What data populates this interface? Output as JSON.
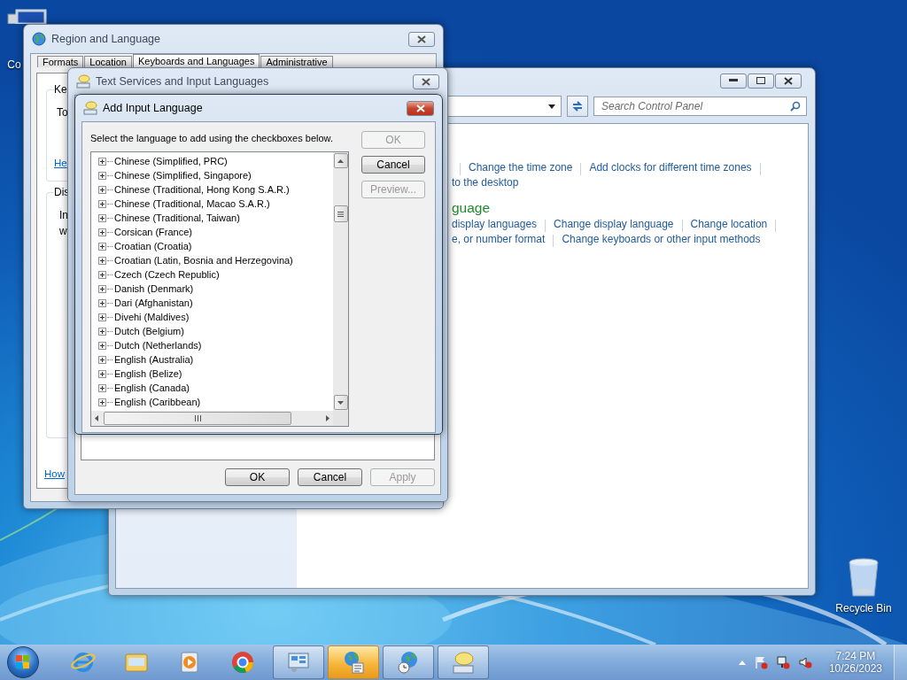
{
  "desktop_icons": [
    {
      "kind": "computer",
      "label": "Co"
    },
    {
      "kind": "recycle-bin",
      "label": "Recycle Bin"
    }
  ],
  "control_panel": {
    "search": {
      "placeholder": "Search Control Panel"
    },
    "content": [
      {
        "kind": "links",
        "separator_before": true,
        "links": [
          {
            "text": "Change the time zone",
            "separator_after": true
          },
          {
            "text": "Add clocks for different time zones",
            "separator_after": true
          }
        ]
      },
      {
        "kind": "links",
        "separator_before": false,
        "links": [
          {
            "text": "to the desktop",
            "separator_after": false
          }
        ]
      },
      {
        "kind": "heading",
        "text": "guage"
      },
      {
        "kind": "links",
        "separator_before": false,
        "links": [
          {
            "text": "display languages",
            "separator_after": true
          },
          {
            "text": "Change display language",
            "separator_after": true
          },
          {
            "text": "Change location",
            "separator_after": true
          }
        ]
      },
      {
        "kind": "links",
        "separator_before": false,
        "links": [
          {
            "text": "e, or number format",
            "separator_after": true
          },
          {
            "text": "Change keyboards or other input methods",
            "separator_after": false
          }
        ]
      }
    ]
  },
  "region_window": {
    "title": "Region and Language",
    "tabs": [
      {
        "label": "Formats",
        "selected": false
      },
      {
        "label": "Location",
        "selected": false
      },
      {
        "label": "Keyboards and Languages",
        "selected": true
      },
      {
        "label": "Administrative",
        "selected": false
      }
    ],
    "groups": [
      {
        "title": "Ke",
        "lines": [
          "To"
        ],
        "link": "He"
      },
      {
        "title": "Dis",
        "lines": [
          "In",
          "w"
        ]
      }
    ],
    "help_link": "How"
  },
  "text_services_window": {
    "title": "Text Services and Input Languages",
    "buttons": [
      {
        "label": "OK",
        "disabled": false
      },
      {
        "label": "Cancel",
        "disabled": false
      },
      {
        "label": "Apply",
        "disabled": true
      }
    ]
  },
  "add_language_dialog": {
    "title": "Add Input Language",
    "instruction": "Select the language to add using the checkboxes below.",
    "languages": [
      {
        "label": "Chinese (Simplified, PRC)",
        "expanded": false
      },
      {
        "label": "Chinese (Simplified, Singapore)",
        "expanded": false
      },
      {
        "label": "Chinese (Traditional, Hong Kong S.A.R.)",
        "expanded": false
      },
      {
        "label": "Chinese (Traditional, Macao S.A.R.)",
        "expanded": false
      },
      {
        "label": "Chinese (Traditional, Taiwan)",
        "expanded": false
      },
      {
        "label": "Corsican (France)",
        "expanded": false
      },
      {
        "label": "Croatian (Croatia)",
        "expanded": false
      },
      {
        "label": "Croatian (Latin, Bosnia and Herzegovina)",
        "expanded": false
      },
      {
        "label": "Czech (Czech Republic)",
        "expanded": false
      },
      {
        "label": "Danish (Denmark)",
        "expanded": false
      },
      {
        "label": "Dari (Afghanistan)",
        "expanded": false
      },
      {
        "label": "Divehi (Maldives)",
        "expanded": false
      },
      {
        "label": "Dutch (Belgium)",
        "expanded": false
      },
      {
        "label": "Dutch (Netherlands)",
        "expanded": false
      },
      {
        "label": "English (Australia)",
        "expanded": false
      },
      {
        "label": "English (Belize)",
        "expanded": false
      },
      {
        "label": "English (Canada)",
        "expanded": false
      },
      {
        "label": "English (Caribbean)",
        "expanded": false
      }
    ],
    "buttons": [
      {
        "label": "OK",
        "disabled": true
      },
      {
        "label": "Cancel",
        "disabled": false
      },
      {
        "label": "Preview...",
        "disabled": true
      }
    ]
  },
  "taskbar": {
    "pinned": [
      {
        "kind": "browser-e"
      },
      {
        "kind": "folder"
      },
      {
        "kind": "media"
      },
      {
        "kind": "chrome"
      }
    ],
    "windows": [
      {
        "kind": "control-panel",
        "selected": false
      },
      {
        "kind": "region",
        "selected": true
      },
      {
        "kind": "clock-globe",
        "selected": false
      },
      {
        "kind": "text-services",
        "selected": false
      }
    ],
    "clock": {
      "time": "7:24 PM",
      "date": "10/26/2023"
    }
  }
}
